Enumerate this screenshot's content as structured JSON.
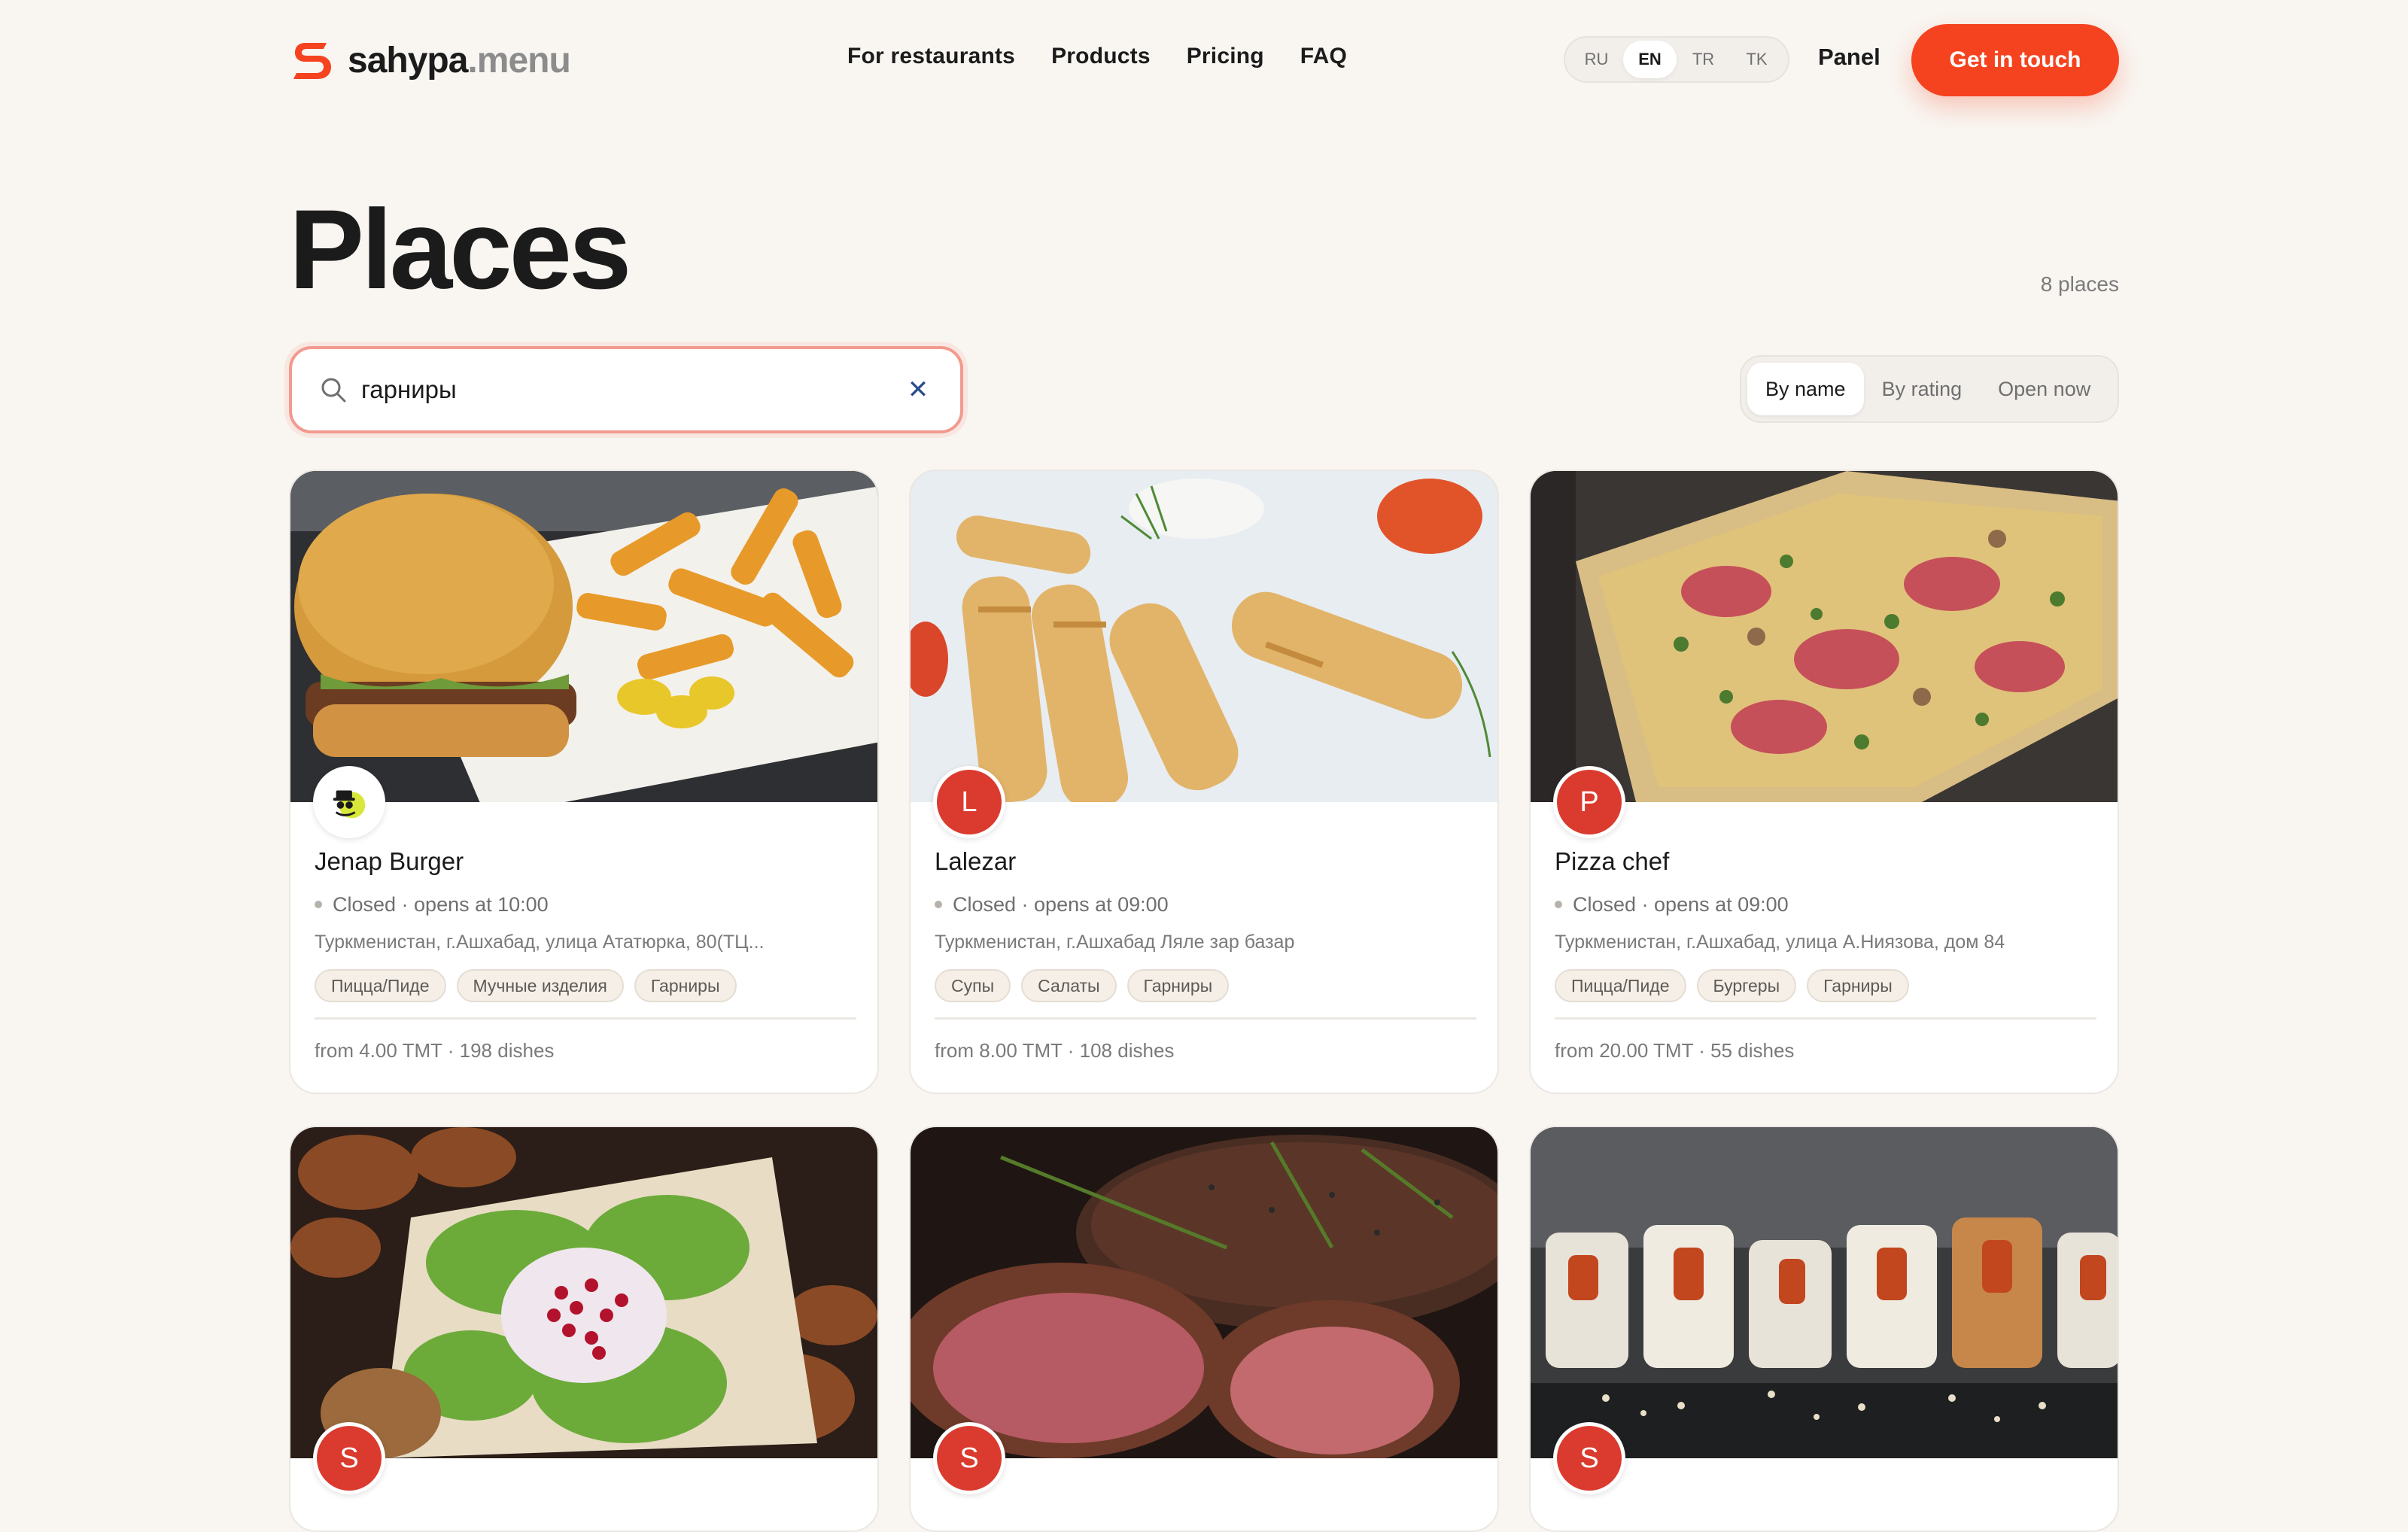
{
  "header": {
    "logo_main": "sahypa",
    "logo_sub": ".menu",
    "nav": [
      "For restaurants",
      "Products",
      "Pricing",
      "FAQ"
    ],
    "languages": [
      "RU",
      "EN",
      "TR",
      "TK"
    ],
    "active_language": "EN",
    "panel_label": "Panel",
    "cta_label": "Get in touch",
    "accent_color": "#f5431f"
  },
  "page": {
    "title": "Places",
    "count": "8 places"
  },
  "search": {
    "value": "гарниры",
    "placeholder": "",
    "clear_icon": "close-icon"
  },
  "sort": {
    "options": [
      "By name",
      "By rating",
      "Open now"
    ],
    "selected": "By name"
  },
  "cards": [
    {
      "name": "Jenap Burger",
      "avatar": "",
      "status": "Closed · opens at 10:00",
      "address": "Туркменистан, г.Ашхабад, улица Ататюрка, 80(ТЦ...",
      "tags": [
        "Пицца/Пиде",
        "Мучные изделия",
        "Гарниры"
      ],
      "meta": "from 4.00 TMT · 198 dishes",
      "photo": "burger-photo"
    },
    {
      "name": "Lalezar",
      "avatar": "L",
      "status": "Closed · opens at 09:00",
      "address": "Туркменистан, г.Ашхабад Ляле зар базар",
      "tags": [
        "Супы",
        "Салаты",
        "Гарниры"
      ],
      "meta": "from 8.00 TMT · 108 dishes",
      "photo": "rolls-photo"
    },
    {
      "name": "Pizza chef",
      "avatar": "P",
      "status": "Closed · opens at 09:00",
      "address": "Туркменистан, г.Ашхабад, улица А.Ниязова, дом 84",
      "tags": [
        "Пицца/Пиде",
        "Бургеры",
        "Гарниры"
      ],
      "meta": "from 20.00 TMT · 55 dishes",
      "photo": "pizza-photo"
    },
    {
      "avatar": "S",
      "photo": "kebab-salad-photo"
    },
    {
      "avatar": "S",
      "photo": "steak-photo"
    },
    {
      "avatar": "S",
      "photo": "sushi-photo"
    }
  ]
}
